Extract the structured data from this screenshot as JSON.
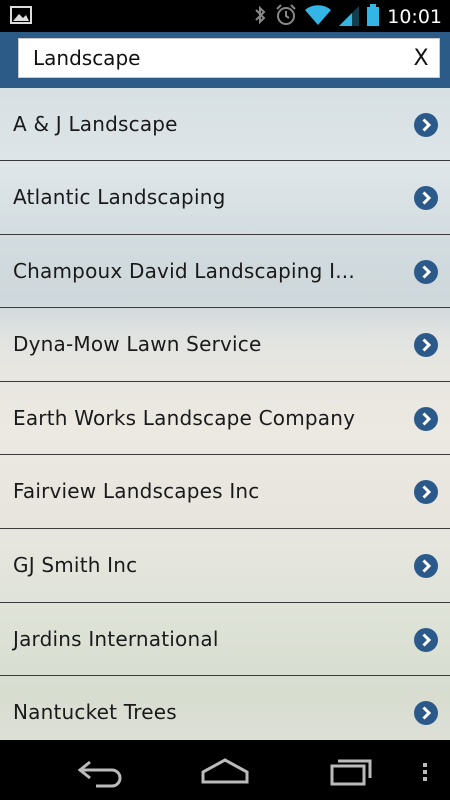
{
  "status_bar": {
    "time": "10:01",
    "icons": [
      "image-notification-icon",
      "bluetooth-icon",
      "alarm-icon",
      "wifi-icon",
      "signal-icon",
      "battery-icon"
    ]
  },
  "search": {
    "value": "Landscape",
    "clear_label": "X"
  },
  "results": [
    {
      "label": "A & J Landscape"
    },
    {
      "label": "Atlantic Landscaping"
    },
    {
      "label": "Champoux David Landscaping I..."
    },
    {
      "label": "Dyna-Mow Lawn Service"
    },
    {
      "label": "Earth Works Landscape Company"
    },
    {
      "label": "Fairview Landscapes Inc"
    },
    {
      "label": "GJ Smith Inc"
    },
    {
      "label": "Jardins International"
    },
    {
      "label": "Nantucket Trees"
    }
  ],
  "nav_bar": {
    "buttons": [
      "back-icon",
      "home-icon",
      "recent-apps-icon",
      "menu-icon"
    ]
  },
  "colors": {
    "header": "#2d5b87",
    "chevron": "#2b5a8a",
    "divider": "#3a3a3a"
  }
}
